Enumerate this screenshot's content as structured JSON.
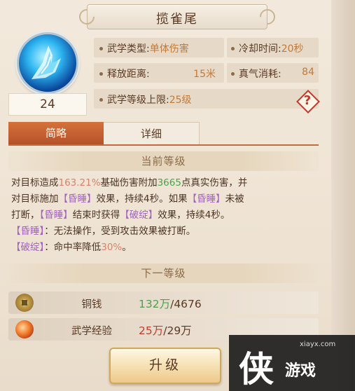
{
  "skill": {
    "title": "揽雀尾",
    "level": "24",
    "type_label": "武学类型:",
    "type_value": "单体伤害",
    "cooldown_label": "冷却时间:",
    "cooldown_value": "20秒",
    "range_label": "释放距离:",
    "range_value": "15米",
    "qi_label": "真气消耗:",
    "qi_value": "84",
    "max_level_label": "武学等级上限:",
    "max_level_value": "25级",
    "help_glyph": "?"
  },
  "tabs": [
    {
      "label": "简略",
      "active": true
    },
    {
      "label": "详细",
      "active": false
    }
  ],
  "current_level": {
    "header": "当前等级",
    "line1_a": "对目标造成",
    "line1_b": "163.21%",
    "line1_c": "基础伤害附加",
    "line1_d": "3665",
    "line1_e": "点真实伤害，并",
    "line2_a": "对目标施加",
    "line2_b": "【昏睡】",
    "line2_c": "效果，持续4秒。如果",
    "line2_d": "【昏睡】",
    "line2_e": "未被",
    "line3_a": "打断，",
    "line3_b": "【昏睡】",
    "line3_c": "结束时获得",
    "line3_d": "【破绽】",
    "line3_e": "效果，持续4秒。",
    "line4_a": "【昏睡】",
    "line4_b": "：无法操作，受到攻击效果被打断。",
    "line5_a": "【破绽】",
    "line5_b": "：命中率降低",
    "line5_c": "30%",
    "line5_d": "。"
  },
  "next_level": {
    "header": "下一等级",
    "costs": [
      {
        "icon": "copper-coin-icon",
        "name": "铜钱",
        "have": "132万",
        "need": "/4676"
      },
      {
        "icon": "martial-exp-icon",
        "name": "武学经验",
        "have": "25万",
        "need": "/29万"
      }
    ]
  },
  "upgrade_button": "升级",
  "watermark": {
    "site": "xiayx.com",
    "logo_char": "侠",
    "brand": "游戏"
  },
  "colors": {
    "accent": "#c96a35",
    "highlight_red": "#d9826a",
    "highlight_green": "#4aa24a",
    "highlight_purple": "#a260c6",
    "value_orange": "#c07a3a"
  }
}
